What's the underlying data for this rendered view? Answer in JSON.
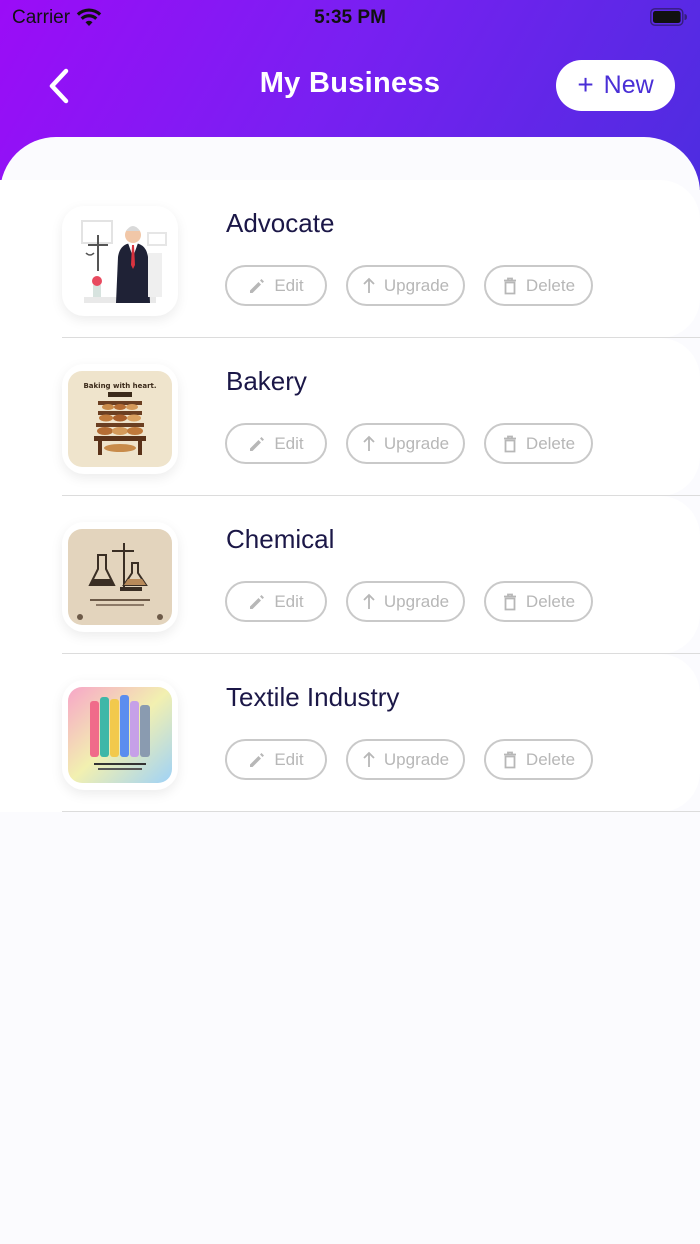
{
  "status_bar": {
    "carrier": "Carrier",
    "time": "5:35 PM"
  },
  "nav": {
    "title": "My Business",
    "new_label": "New"
  },
  "actions": {
    "edit": "Edit",
    "upgrade": "Upgrade",
    "delete": "Delete"
  },
  "businesses": [
    {
      "name": "Advocate",
      "image": "advocate-illustration"
    },
    {
      "name": "Bakery",
      "image": "bakery-illustration",
      "image_text": "Baking with heart."
    },
    {
      "name": "Chemical",
      "image": "chemical-illustration"
    },
    {
      "name": "Textile Industry",
      "image": "textile-illustration"
    }
  ],
  "colors": {
    "gradient_start": "#9b0cf7",
    "gradient_end": "#4d2de0",
    "accent": "#4a2fd6",
    "title_text": "#1b1747",
    "action_border": "#c9c9c9"
  }
}
